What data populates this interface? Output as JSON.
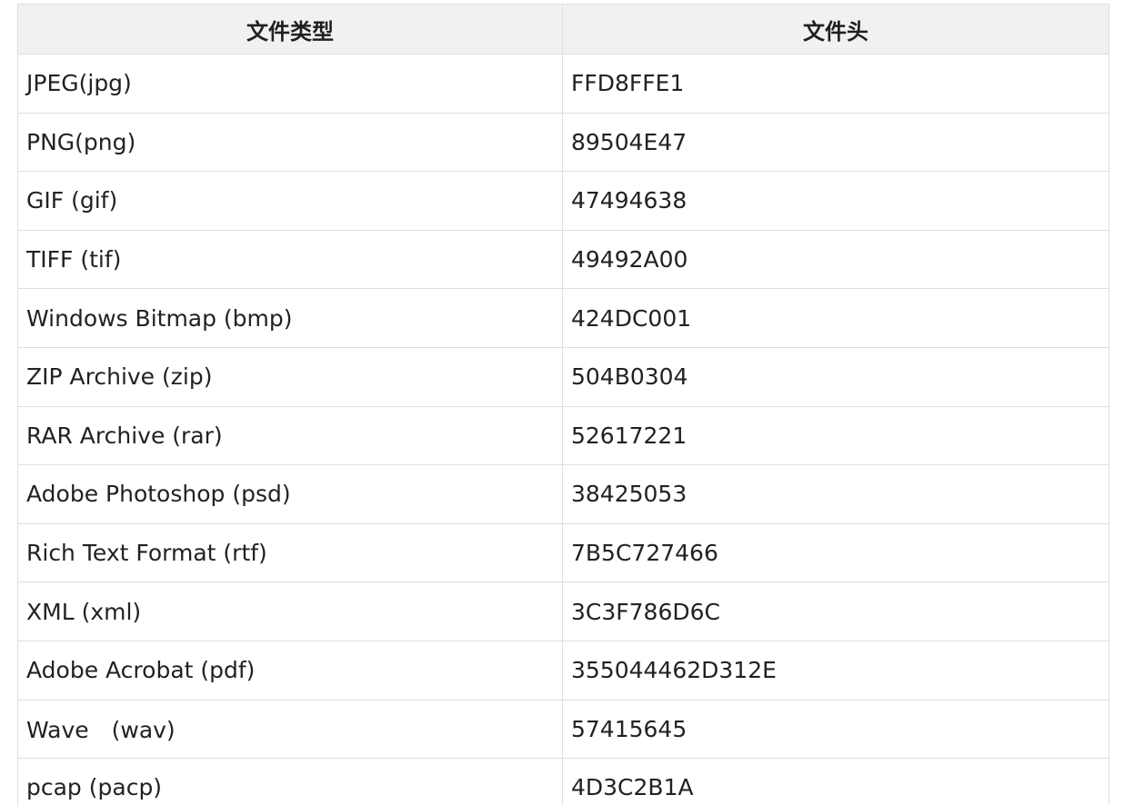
{
  "table": {
    "headers": [
      "文件类型",
      "文件头"
    ],
    "rows": [
      [
        "JPEG(jpg)",
        "FFD8FFE1"
      ],
      [
        "PNG(png)",
        "89504E47"
      ],
      [
        "GIF (gif)",
        "47494638"
      ],
      [
        "TIFF (tif)",
        "49492A00"
      ],
      [
        "Windows Bitmap (bmp)",
        "424DC001"
      ],
      [
        "ZIP Archive (zip)",
        "504B0304"
      ],
      [
        "RAR Archive (rar)",
        "52617221"
      ],
      [
        "Adobe Photoshop (psd)",
        "38425053"
      ],
      [
        "Rich Text Format (rtf)",
        "7B5C727466"
      ],
      [
        "XML (xml)",
        "3C3F786D6C"
      ],
      [
        "Adobe Acrobat (pdf)",
        "355044462D312E"
      ],
      [
        "Wave　(wav)",
        "57415645"
      ],
      [
        "pcap (pacp)",
        "4D3C2B1A"
      ]
    ]
  }
}
